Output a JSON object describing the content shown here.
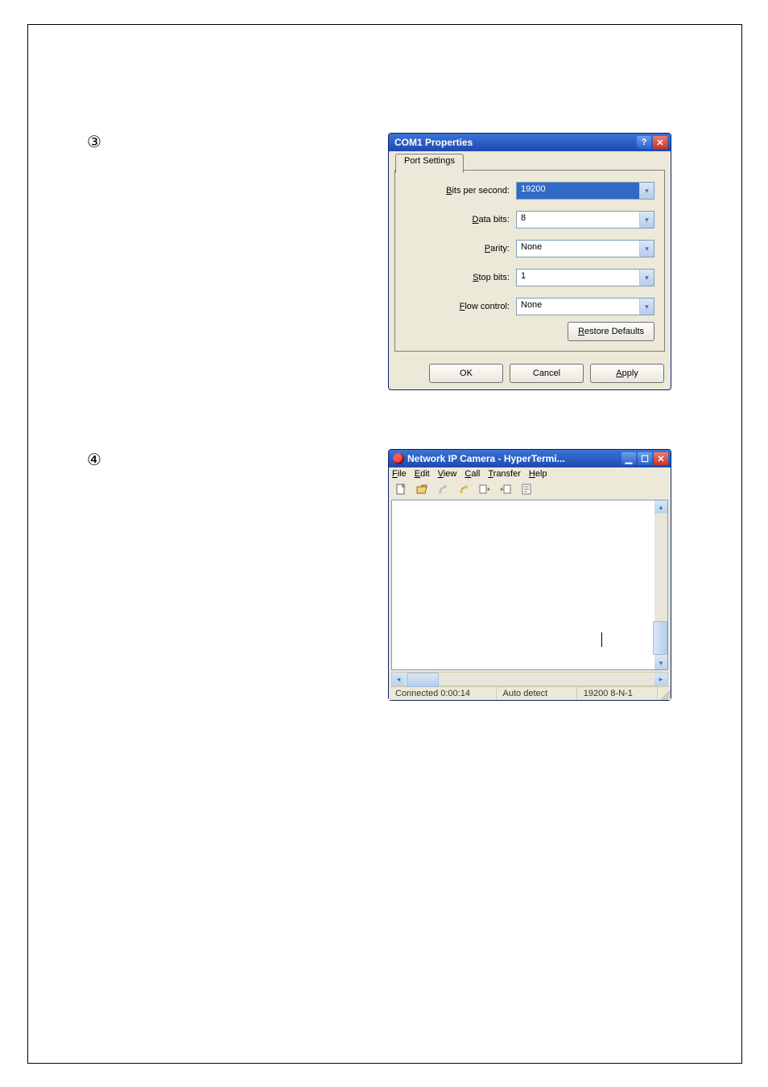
{
  "markers": {
    "item3": "③",
    "item4": "④"
  },
  "dialog1": {
    "title": "COM1 Properties",
    "tab": "Port Settings",
    "fields": {
      "bits_per_second": {
        "label_pre": "B",
        "label_post": "its per second:",
        "value": "19200"
      },
      "data_bits": {
        "label_pre": "D",
        "label_post": "ata bits:",
        "value": "8"
      },
      "parity": {
        "label_pre": "P",
        "label_post": "arity:",
        "value": "None"
      },
      "stop_bits": {
        "label_pre": "S",
        "label_post": "top bits:",
        "value": "1"
      },
      "flow_control": {
        "label_pre": "F",
        "label_post": "low control:",
        "value": "None"
      }
    },
    "restore_pre": "R",
    "restore_post": "estore Defaults",
    "buttons": {
      "ok": "OK",
      "cancel": "Cancel",
      "apply_pre": "A",
      "apply_post": "pply"
    }
  },
  "win2": {
    "title": "Network IP Camera - HyperTermi...",
    "menu": {
      "file": {
        "pre": "F",
        "post": "ile"
      },
      "edit": {
        "pre": "E",
        "post": "dit"
      },
      "view": {
        "pre": "V",
        "post": "iew"
      },
      "call": {
        "pre": "C",
        "post": "all"
      },
      "transfer": {
        "pre": "T",
        "post": "ransfer"
      },
      "help": {
        "pre": "H",
        "post": "elp"
      }
    },
    "status": {
      "connected": "Connected 0:00:14",
      "mode": "Auto detect",
      "settings": "19200 8-N-1"
    }
  }
}
